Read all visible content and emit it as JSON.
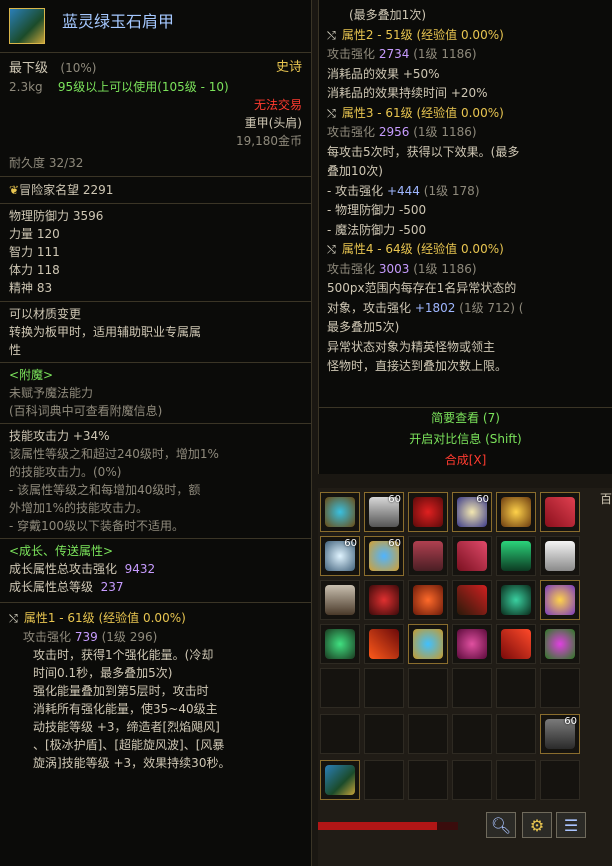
{
  "item": {
    "name": "蓝灵绿玉石肩甲",
    "grade": "最下级",
    "grade_pct": "(10%)",
    "rarity": "史诗",
    "weight": "2.3kg",
    "level_req": "95级以上可以使用(105级 - 10)",
    "trade": "无法交易",
    "type": "重甲(头肩)",
    "price": "19,180金币",
    "durability": "耐久度 32/32",
    "adventurer_fame": "冒险家名望",
    "fame_value": "2291",
    "stats": [
      {
        "label": "物理防御力",
        "value": "3596"
      },
      {
        "label": "力量",
        "value": "120"
      },
      {
        "label": "智力",
        "value": "111"
      },
      {
        "label": "体力",
        "value": "118"
      },
      {
        "label": "精神",
        "value": "83"
      }
    ],
    "material_change": "可以材质变更",
    "convert_text": "转换为板甲时，适用辅助职业专属属",
    "convert_text2": "性",
    "enchant_title": "<附魔>",
    "enchant_none": "未赋予魔法能力",
    "enchant_hint": "(百科词典中可查看附魔信息)",
    "skill_atk": "技能攻击力 +34%",
    "skill_desc": [
      "该属性等级之和超过240级时，增加1%",
      "的技能攻击力。(0%)",
      "- 该属性等级之和每增加40级时，额",
      "外增加1%的技能攻击力。",
      "- 穿戴100级以下装备时不适用。"
    ],
    "growth_title": "<成长、传送属性>",
    "growth_total_atk_label": "成长属性总攻击强化",
    "growth_total_atk": "9432",
    "growth_total_lv_label": "成长属性总等级",
    "growth_total_lv": "237",
    "attr1": {
      "title": "属性1 - 61级 (经验值 0.00%)",
      "atk_label": "攻击强化",
      "atk": "739",
      "atk_lv": "(1级 296)",
      "lines": [
        "攻击时，获得1个强化能量。(冷却",
        "时间0.1秒，最多叠加5次)",
        "强化能量叠加到第5层时，攻击时",
        "消耗所有强化能量，使35~40级主",
        "动技能等级 +3，缔造者[烈焰飓风]",
        "、[极冰护盾]、[超能旋风波]、[风暴",
        "旋涡]技能等级 +3，效果持续30秒。"
      ]
    }
  },
  "right": {
    "top_line": "(最多叠加1次)",
    "attr2": {
      "title": "属性2 - 51级 (经验值 0.00%)",
      "atk_label": "攻击强化",
      "atk": "2734",
      "atk_lv": "(1级 1186)",
      "lines": [
        "消耗品的效果 +50%",
        "消耗品的效果持续时间 +20%"
      ]
    },
    "attr3": {
      "title": "属性3 - 61级 (经验值 0.00%)",
      "atk_label": "攻击强化",
      "atk": "2956",
      "atk_lv": "(1级 1186)",
      "line1": "每攻击5次时，获得以下效果。(最多",
      "line2": "叠加10次)",
      "sub1_label": "- 攻击强化",
      "sub1_val": "+444",
      "sub1_lv": "(1级 178)",
      "sub2": "- 物理防御力 -500",
      "sub3": "- 魔法防御力 -500"
    },
    "attr4": {
      "title": "属性4 - 64级 (经验值 0.00%)",
      "atk_label": "攻击强化",
      "atk": "3003",
      "atk_lv": "(1级 1186)",
      "line1": "500px范围内每存在1名异常状态的",
      "line2a": "对象，攻击强化",
      "line2_val": "+1802",
      "line2_lv": "(1级 712) (",
      "line3": "最多叠加5次)",
      "line4": "异常状态对象为精英怪物或领主",
      "line5": "怪物时，直接达到叠加次数上限。"
    },
    "brief_view": "简要查看 (7)",
    "compare": "开启对比信息 (Shift)",
    "compose": "合成[X]"
  },
  "inventory": {
    "edge_label": "百",
    "levels": [
      "60",
      "60",
      "60",
      "60",
      "60"
    ],
    "hp_fraction": 0.85
  },
  "colors": {
    "accent_gold": "#e8c550",
    "green": "#7be35b",
    "red": "#ff3b2f",
    "blue": "#9fb7ff",
    "purple": "#c79cff"
  }
}
